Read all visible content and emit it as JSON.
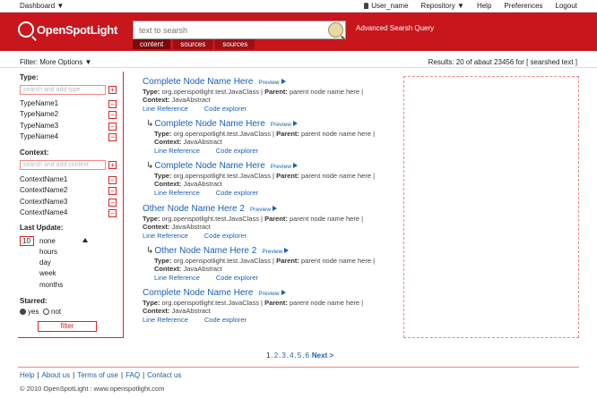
{
  "topbar": {
    "dashboard": "Dashboard ▼",
    "user": "User_name",
    "repository": "Repository ▼",
    "help": "Help",
    "preferences": "Preferences",
    "logout": "Logout"
  },
  "header": {
    "logo": "OpenSpotLight",
    "search_placeholder": "text to searsh",
    "advanced": "Advanced Searsh Query",
    "tabs": [
      "content",
      "sources",
      "sources"
    ]
  },
  "filterbar": {
    "label": "Filter:",
    "more": "More Options ▼",
    "results": "Results: 20 of abaut  23456 for [ searshed text ]"
  },
  "sidebar": {
    "type_title": "Type:",
    "type_placeholder": "searsh and add type",
    "types": [
      "TypeName1",
      "TypeName2",
      "TypeName3",
      "TypeName4"
    ],
    "context_title": "Context:",
    "context_placeholder": "searsh and add context",
    "contexts": [
      "ContextName1",
      "ContextName2",
      "ContextName3",
      "ContextName4"
    ],
    "last_update_title": "Last Update:",
    "last_update_value": "10",
    "last_update_options": [
      "none",
      "hours",
      "day",
      "week",
      "months"
    ],
    "starred_title": "Starred:",
    "starred_yes": "yes",
    "starred_not": "not",
    "filter_button": "filter",
    "plus": "+",
    "minus": "−"
  },
  "results": [
    {
      "title": "Complete Node Name Here",
      "preview": "Preview",
      "type_label": "Type:",
      "type": "org.openspotlight.test.JavaClass",
      "parent_label": "Parent:",
      "parent": "parent node name here",
      "context_label": "Context:",
      "context": "JavaAbstract",
      "link1": "Line Reference",
      "link2": "Code explorer",
      "nested": false
    },
    {
      "title": "Complete Node Name Here",
      "preview": "Preview",
      "type_label": "Type:",
      "type": "org.openspotlight.test.JavaClass",
      "parent_label": "Parent:",
      "parent": "parent node name here",
      "context_label": "Context:",
      "context": "JavaAbstract",
      "link1": "Line Reference",
      "link2": "Code explorer",
      "nested": true
    },
    {
      "title": "Complete Node Name Here",
      "preview": "Preview",
      "type_label": "Type:",
      "type": "org.openspotlight.test.JavaClass",
      "parent_label": "Parent:",
      "parent": "parent node name here",
      "context_label": "Context:",
      "context": "JavaAbstract",
      "link1": "Line Reference",
      "link2": "Code explorer",
      "nested": true
    },
    {
      "title": "Other Node Name Here 2",
      "preview": "Preview",
      "type_label": "Type:",
      "type": "org.openspotlight.test.JavaClass",
      "parent_label": "Parent:",
      "parent": "parent node name here",
      "context_label": "Context:",
      "context": "JavaAbstract",
      "link1": "Line Reference",
      "link2": "Code explorer",
      "nested": false
    },
    {
      "title": "Other Node Name Here 2",
      "preview": "Preview",
      "type_label": "Type:",
      "type": "org.openspotlight.test.JavaClass",
      "parent_label": "Parent:",
      "parent": "parent node name here",
      "context_label": "Context:",
      "context": "JavaAbstract",
      "link1": "Line Reference",
      "link2": "Code explorer",
      "nested": true
    },
    {
      "title": "Complete Node Name Here",
      "preview": "Preview",
      "type_label": "Type:",
      "type": "org.openspotlight.test.JavaClass",
      "parent_label": "Parent:",
      "parent": "parent node name here",
      "context_label": "Context:",
      "context": "JavaAbstract",
      "link1": "Line Reference",
      "link2": "Code explorer",
      "nested": false
    }
  ],
  "pagination": {
    "pages": [
      "1",
      "2",
      "3",
      "4",
      "5",
      "6"
    ],
    "current": "1",
    "next": "Next >"
  },
  "footer": {
    "links": [
      "Help",
      "About us",
      "Terms of use",
      "FAQ",
      "Contact us"
    ],
    "copyright": "© 2010 OpenSpotLight : www.openspotlight.com"
  },
  "colors": {
    "brand_red": "#c8161d",
    "link_blue": "#1a5fb4"
  }
}
